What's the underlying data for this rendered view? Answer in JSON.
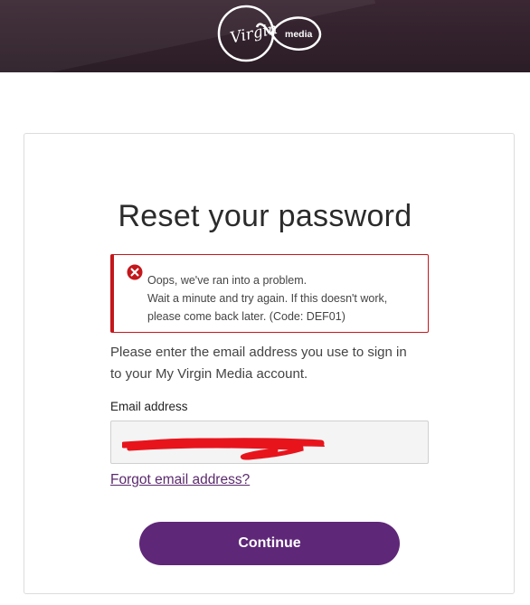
{
  "header": {
    "logo_text": "Virgin media"
  },
  "main": {
    "title": "Reset your password",
    "error": {
      "line1": "Oops, we've ran into a problem.",
      "line2": "Wait a minute and try again. If this doesn't work,",
      "line3": "please come back later. (Code: DEF01)"
    },
    "intro_line1": "Please enter the email address you use to sign in",
    "intro_line2": "to your My Virgin Media account.",
    "email_label": "Email address",
    "email_value": "",
    "forgot_link": "Forgot email address?",
    "continue_label": "Continue"
  },
  "colors": {
    "header_bg": "#2e1f28",
    "accent": "#5f2778",
    "error": "#c4171c",
    "redaction": "#e8141c"
  }
}
